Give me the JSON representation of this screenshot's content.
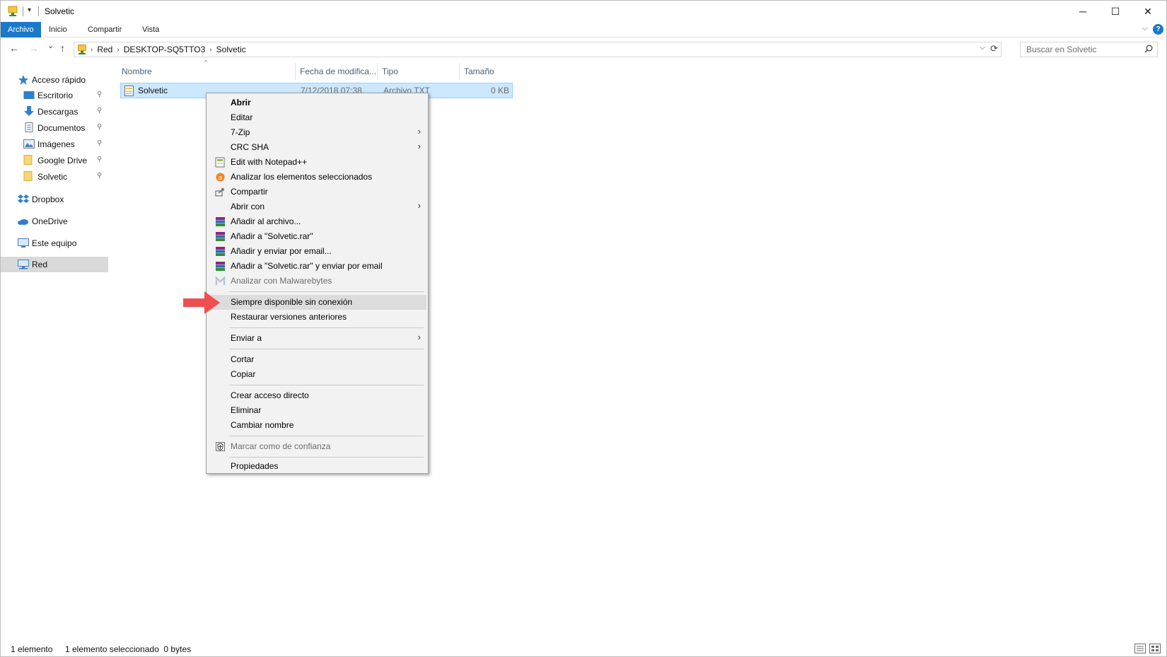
{
  "window": {
    "title": "Solvetic",
    "minimize_glyph": "─",
    "maximize_glyph": "☐",
    "close_glyph": "✕"
  },
  "quick_access_toolbar": {
    "dropdown_glyph": "▾"
  },
  "ribbon": {
    "tabs": [
      {
        "label": "Archivo",
        "active": true
      },
      {
        "label": "Inicio",
        "active": false
      },
      {
        "label": "Compartir",
        "active": false
      },
      {
        "label": "Vista",
        "active": false
      }
    ],
    "expand_glyph": "⌵",
    "help_glyph": "?"
  },
  "navigation": {
    "back_glyph": "←",
    "forward_glyph": "→",
    "recent_glyph": "⌄",
    "up_glyph": "↑",
    "breadcrumb": [
      "Red",
      "DESKTOP-SQ5TTO3",
      "Solvetic"
    ],
    "breadcrumb_sep": "›",
    "dropdown_glyph": "⌵",
    "refresh_glyph": "⟳",
    "search_placeholder": "Buscar en Solvetic"
  },
  "sidebar": {
    "items": [
      {
        "label": "Acceso rápido",
        "icon": "star-icon",
        "pinned": false
      },
      {
        "label": "Escritorio",
        "icon": "desktop-icon",
        "pinned": true
      },
      {
        "label": "Descargas",
        "icon": "download-icon",
        "pinned": true
      },
      {
        "label": "Documentos",
        "icon": "document-icon",
        "pinned": true
      },
      {
        "label": "Imágenes",
        "icon": "pictures-icon",
        "pinned": true
      },
      {
        "label": "Google Drive",
        "icon": "folder-icon",
        "pinned": true
      },
      {
        "label": "Solvetic",
        "icon": "folder-icon",
        "pinned": true
      },
      {
        "label": "Dropbox",
        "icon": "dropbox-icon",
        "pinned": false
      },
      {
        "label": "OneDrive",
        "icon": "onedrive-icon",
        "pinned": false
      },
      {
        "label": "Este equipo",
        "icon": "computer-icon",
        "pinned": false
      },
      {
        "label": "Red",
        "icon": "network-icon",
        "pinned": false,
        "selected": true
      }
    ],
    "pin_glyph": "📌"
  },
  "file_list": {
    "columns": [
      "Nombre",
      "Fecha de modifica...",
      "Tipo",
      "Tamaño"
    ],
    "sort_glyph": "^",
    "rows": [
      {
        "name": "Solvetic",
        "date": "7/12/2018 07:38",
        "type": "Archivo TXT",
        "size": "0 KB",
        "selected": true
      }
    ]
  },
  "context_menu": {
    "items": [
      {
        "label": "Abrir",
        "bold": true
      },
      {
        "label": "Editar"
      },
      {
        "label": "7-Zip",
        "submenu": true
      },
      {
        "label": "CRC SHA",
        "submenu": true
      },
      {
        "label": "Edit with Notepad++",
        "icon": "notepad-plus-plus-icon"
      },
      {
        "label": "Analizar los elementos seleccionados",
        "icon": "avast-icon"
      },
      {
        "label": "Compartir",
        "icon": "share-icon"
      },
      {
        "label": "Abrir con",
        "submenu": true
      },
      {
        "label": "Añadir al archivo...",
        "icon": "winrar-icon"
      },
      {
        "label": "Añadir a \"Solvetic.rar\"",
        "icon": "winrar-icon"
      },
      {
        "label": "Añadir y enviar por email...",
        "icon": "winrar-icon"
      },
      {
        "label": "Añadir a \"Solvetic.rar\" y enviar por email",
        "icon": "winrar-icon"
      },
      {
        "label": "Analizar con Malwarebytes",
        "icon": "malwarebytes-icon",
        "disabled": true
      },
      {
        "label": "Siempre disponible sin conexión",
        "highlighted": true
      },
      {
        "label": "Restaurar versiones anteriores"
      },
      {
        "label": "Enviar a",
        "submenu": true
      },
      {
        "label": "Cortar"
      },
      {
        "label": "Copiar"
      },
      {
        "label": "Crear acceso directo"
      },
      {
        "label": "Eliminar"
      },
      {
        "label": "Cambiar nombre"
      },
      {
        "label": "Marcar como de confianza",
        "icon": "trust-shield-icon",
        "disabled": true
      },
      {
        "label": "Propiedades"
      }
    ],
    "submenu_glyph": "›"
  },
  "status_bar": {
    "item_count": "1 elemento",
    "selection": "1 elemento seleccionado  0 bytes"
  },
  "colors": {
    "accent": "#1979ca",
    "selection_bg": "#cce8ff",
    "annotation_arrow": "#f04e4e"
  }
}
